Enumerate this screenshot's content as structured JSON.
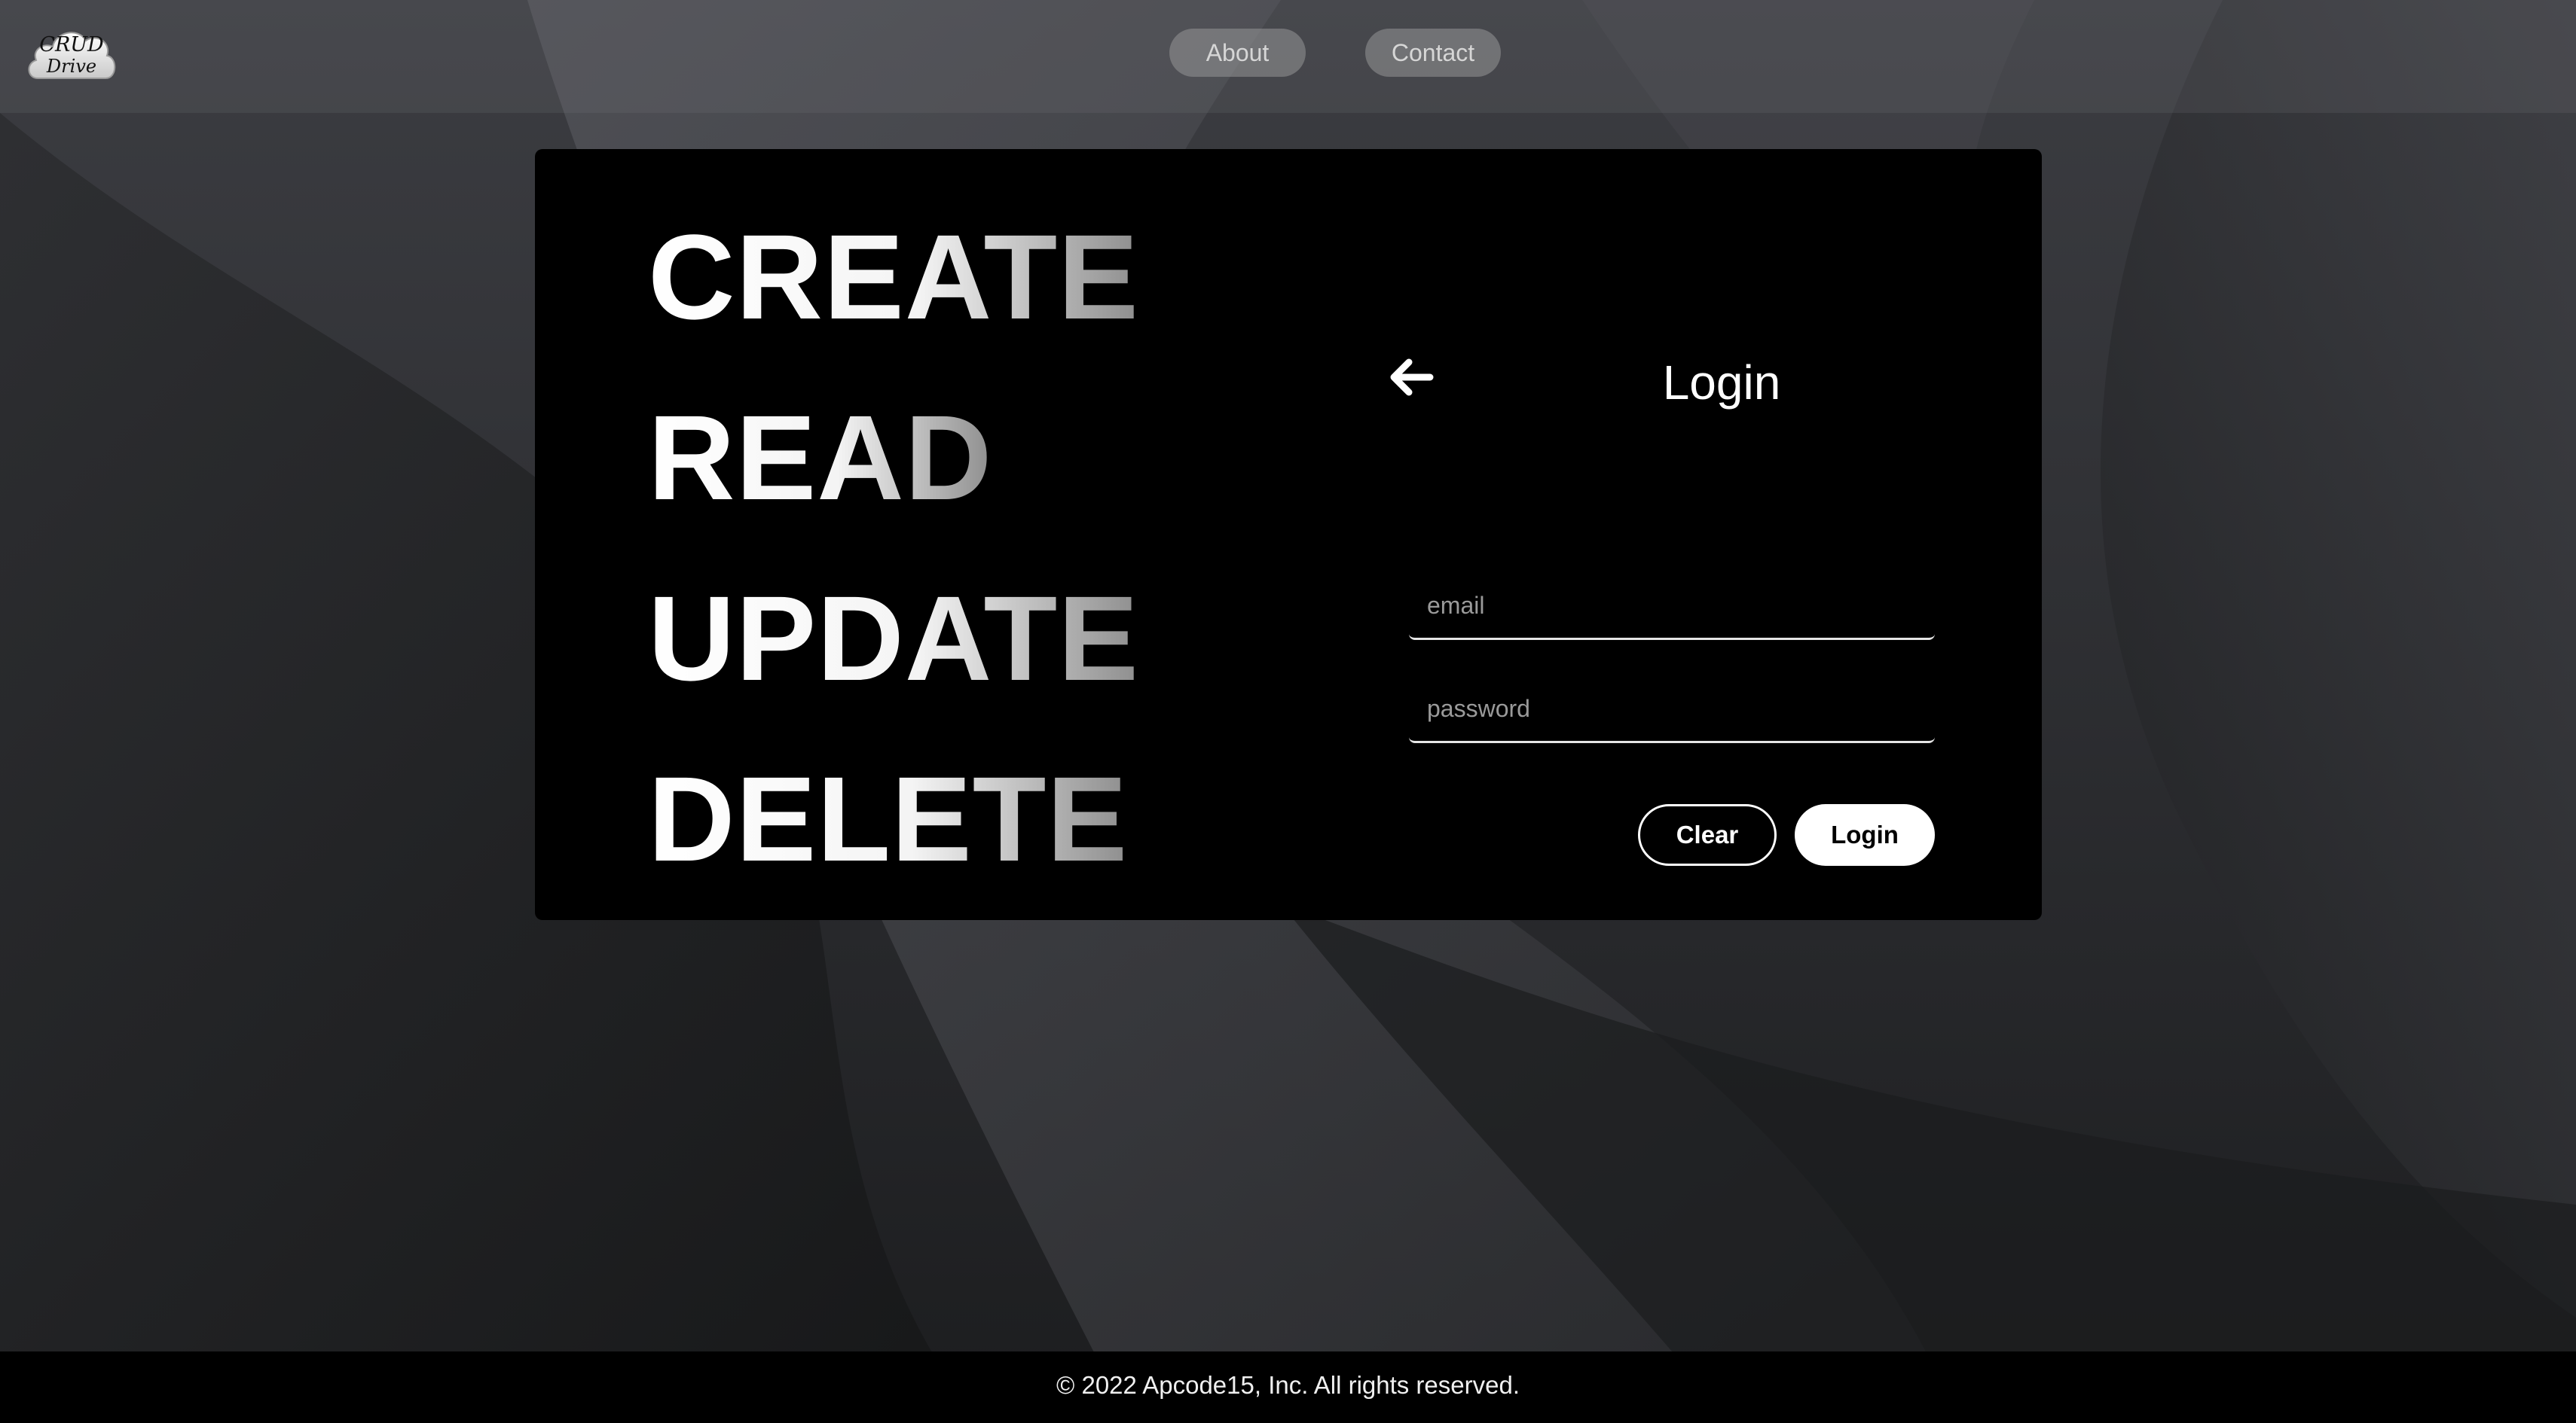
{
  "logo": {
    "line1": "CRUD",
    "line2": "Drive"
  },
  "nav": {
    "items": [
      {
        "label": "About"
      },
      {
        "label": "Contact"
      }
    ]
  },
  "hero": {
    "words": [
      "CREATE",
      "READ",
      "UPDATE",
      "DELETE"
    ]
  },
  "login": {
    "back_icon": "arrow-left-icon",
    "title": "Login",
    "email": {
      "value": "",
      "placeholder": "email"
    },
    "password": {
      "value": "",
      "placeholder": "password"
    },
    "clear_label": "Clear",
    "submit_label": "Login"
  },
  "footer": {
    "text": "© 2022 Apcode15, Inc. All rights reserved."
  },
  "colors": {
    "card_background": "#000000",
    "page_background": "#2a2b2e",
    "text_primary": "#ffffff"
  }
}
